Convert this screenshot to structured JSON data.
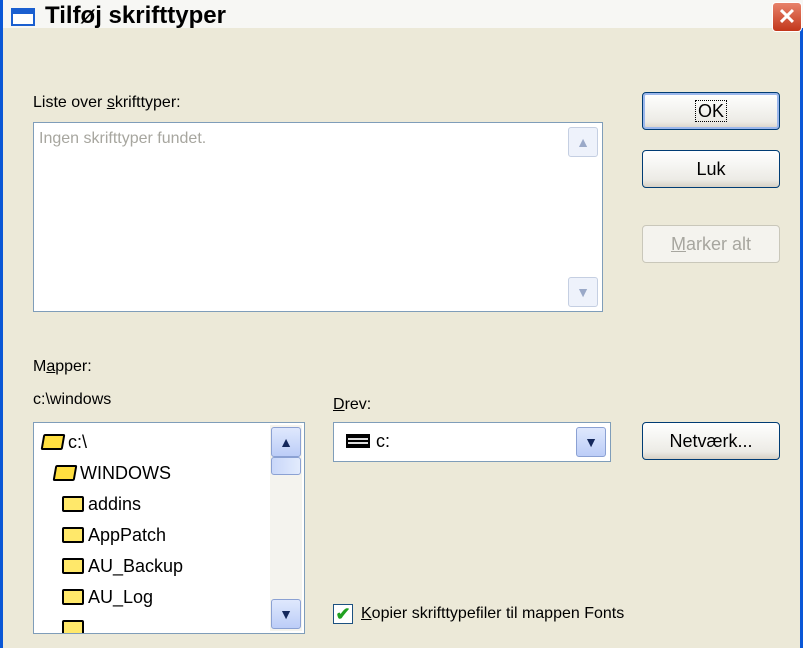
{
  "window": {
    "title": "Tilføj skrifttyper",
    "close_glyph": "✕"
  },
  "fonts_list": {
    "label_pre": "Liste over ",
    "label_u": "s",
    "label_post": "krifttyper:",
    "empty_text": "Ingen skrifttyper fundet."
  },
  "buttons": {
    "ok": "OK",
    "close": "Luk",
    "select_all_u": "M",
    "select_all_rest": "arker alt",
    "network": "Netværk..."
  },
  "folders": {
    "label_pre": "M",
    "label_u": "a",
    "label_post": "pper:",
    "current_path": "c:\\windows",
    "items": [
      "c:\\",
      "WINDOWS",
      "addins",
      "AppPatch",
      "AU_Backup",
      "AU_Log"
    ]
  },
  "drive": {
    "label_u": "D",
    "label_post": "rev:",
    "value": "c:"
  },
  "copy_option": {
    "checked": true,
    "label_u": "K",
    "label_post": "opier skrifttypefiler til mappen Fonts"
  },
  "icons": {
    "folder": "folder-icon",
    "drive": "drive-icon",
    "up": "▲",
    "down": "▼",
    "check": "✔"
  }
}
